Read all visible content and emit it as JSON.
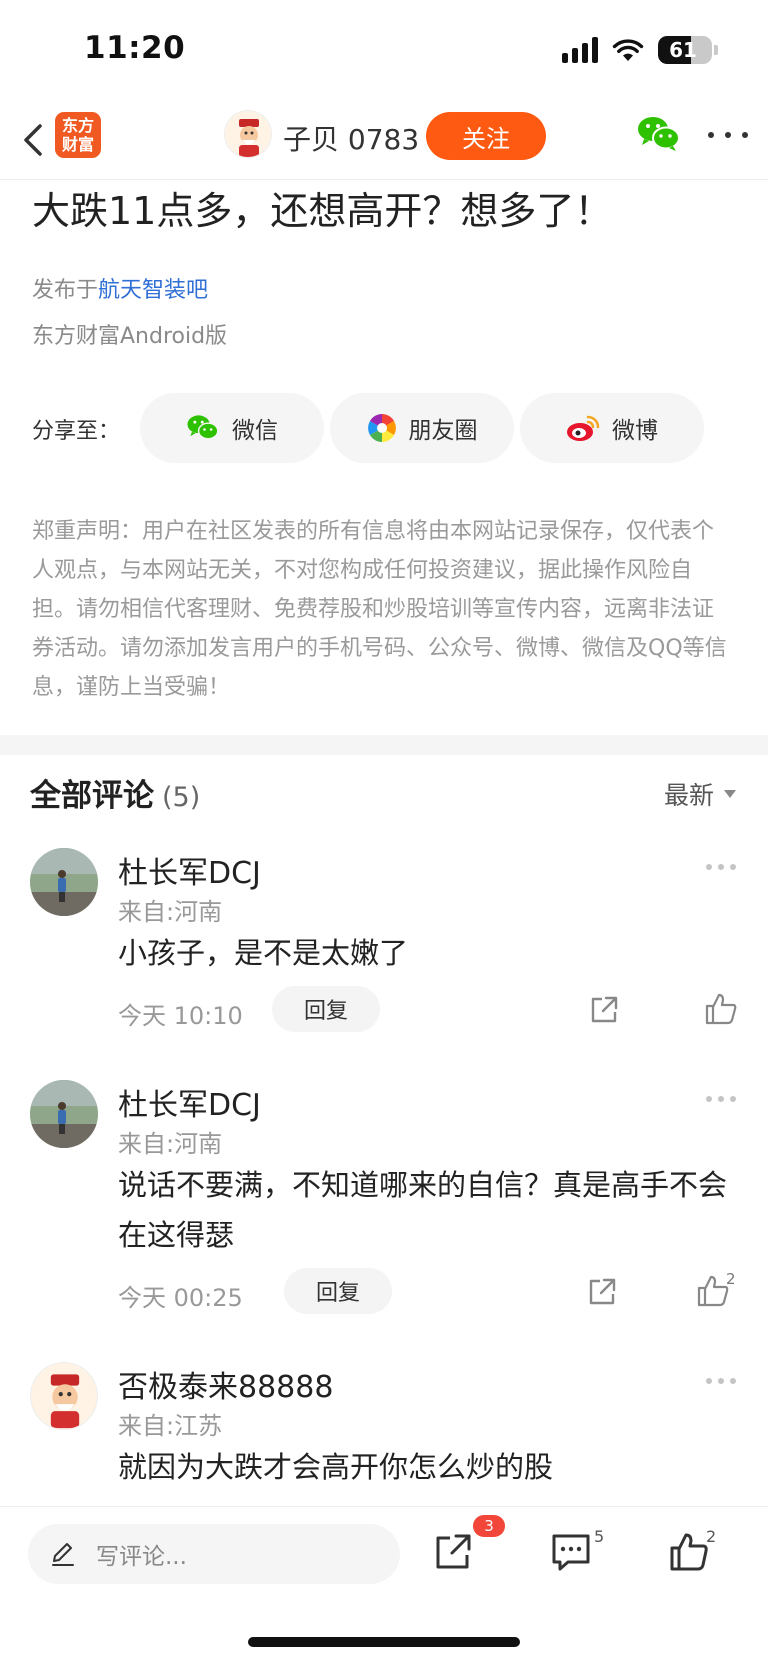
{
  "status_bar": {
    "time": "11:20",
    "battery": "61",
    "battery_level": 0.61
  },
  "nav": {
    "logo_text_line1": "东方",
    "logo_text_line2": "财富",
    "author": "子贝 0783",
    "follow_label": "关注"
  },
  "article": {
    "title": "大跌11点多，还想高开？想多了！",
    "posted_prefix": "发布于",
    "forum": "航天智装吧",
    "client": "东方财富Android版"
  },
  "share": {
    "label": "分享至：",
    "targets": [
      {
        "label": "微信",
        "icon": "wechat-icon"
      },
      {
        "label": "朋友圈",
        "icon": "moments-icon"
      },
      {
        "label": "微博",
        "icon": "weibo-icon"
      }
    ]
  },
  "disclaimer": "郑重声明：用户在社区发表的所有信息将由本网站记录保存，仅代表个人观点，与本网站无关，不对您构成任何投资建议，据此操作风险自担。请勿相信代客理财、免费荐股和炒股培训等宣传内容，远离非法证券活动。请勿添加发言用户的手机号码、公众号、微博、微信及QQ等信息，谨防上当受骗！",
  "comments_section": {
    "title": "全部评论",
    "count": "(5)",
    "sort_label": "最新",
    "items": [
      {
        "name": "杜长军DCJ",
        "location": "来自:河南",
        "text": "小孩子，是不是太嫩了",
        "time": "今天 10:10",
        "reply_label": "回复",
        "likes": ""
      },
      {
        "name": "杜长军DCJ",
        "location": "来自:河南",
        "text": "说话不要满，不知道哪来的自信？真是高手不会在这得瑟",
        "time": "今天 00:25",
        "reply_label": "回复",
        "likes": "2"
      },
      {
        "name": "否极泰来88888",
        "location": "来自:江苏",
        "text": "就因为大跌才会高开你怎么炒的股",
        "time": "",
        "reply_label": "",
        "likes": ""
      }
    ]
  },
  "bottom_bar": {
    "comment_placeholder": "写评论...",
    "share_badge": "3",
    "comment_count": "5",
    "like_count": "2"
  },
  "colors": {
    "brand": "#ff5a12",
    "link": "#2f6fd6",
    "badge": "#f2463a"
  }
}
